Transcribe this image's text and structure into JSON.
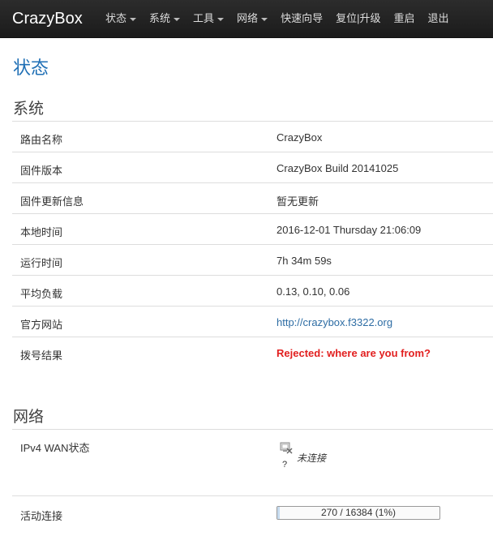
{
  "navbar": {
    "brand": "CrazyBox",
    "items": [
      {
        "label": "状态",
        "dropdown": true
      },
      {
        "label": "系统",
        "dropdown": true
      },
      {
        "label": "工具",
        "dropdown": true
      },
      {
        "label": "网络",
        "dropdown": true
      },
      {
        "label": "快速向导",
        "dropdown": false
      },
      {
        "label": "复位|升级",
        "dropdown": false
      },
      {
        "label": "重启",
        "dropdown": false
      },
      {
        "label": "退出",
        "dropdown": false
      }
    ]
  },
  "page_title": "状态",
  "system": {
    "title": "系统",
    "rows": [
      {
        "label": "路由名称",
        "value": "CrazyBox"
      },
      {
        "label": "固件版本",
        "value": "CrazyBox Build 20141025"
      },
      {
        "label": "固件更新信息",
        "value": "暂无更新"
      },
      {
        "label": "本地时间",
        "value": "2016-12-01 Thursday 21:06:09"
      },
      {
        "label": "运行时间",
        "value": "7h 34m 59s"
      },
      {
        "label": "平均负载",
        "value": "0.13, 0.10, 0.06"
      },
      {
        "label": "官方网站",
        "value": "http://crazybox.f3322.org"
      },
      {
        "label": "拨号结果",
        "value": "Rejected: where are you from?"
      }
    ]
  },
  "network": {
    "title": "网络",
    "wan_label": "IPv4 WAN状态",
    "wan_icon": "network-disconnected-icon",
    "wan_icon_text": "?",
    "wan_status": "未连接",
    "conn_label": "活动连接",
    "conn_text": "270 / 16384 (1%)",
    "conn_fraction": 0.0165
  },
  "colors": {
    "navbar_bg": "#222222",
    "title_blue": "#1f6fb5",
    "link_blue": "#2e6da4",
    "alert_red": "#e21f1f"
  }
}
